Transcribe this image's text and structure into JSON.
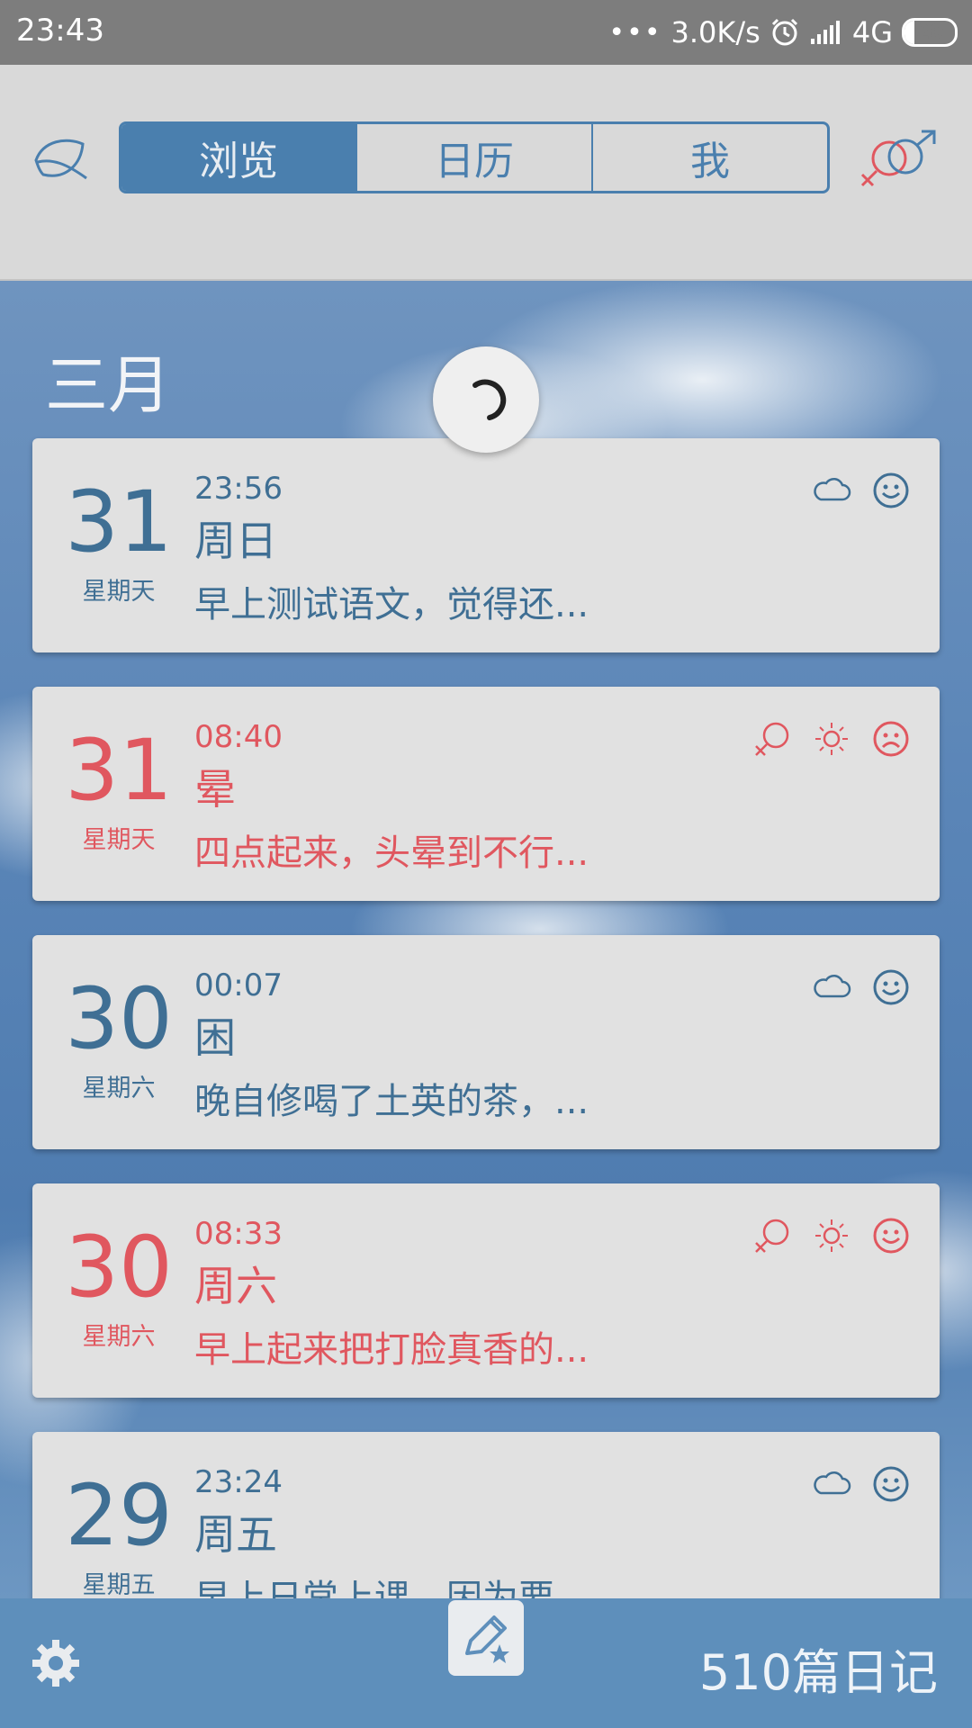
{
  "status_bar": {
    "time": "23:43",
    "dots": "•••",
    "net_speed": "3.0K/s",
    "network": "4G",
    "battery": "20",
    "battery_fraction": 0.2
  },
  "header": {
    "tabs": [
      {
        "label": "浏览",
        "active": true
      },
      {
        "label": "日历",
        "active": false
      },
      {
        "label": "我",
        "active": false
      }
    ],
    "colors": {
      "accent": "#4a7fae",
      "header_bg": "#d9d9d9"
    }
  },
  "month_label": "三月",
  "entries": [
    {
      "day": "31",
      "weekday": "星期天",
      "time": "23:56",
      "title": "周日",
      "excerpt": "早上测试语文，觉得还...",
      "theme": "blue",
      "icons": [
        "cloud-icon",
        "smile-face-icon"
      ]
    },
    {
      "day": "31",
      "weekday": "星期天",
      "time": "08:40",
      "title": "晕",
      "excerpt": "四点起来，头晕到不行...",
      "theme": "red",
      "icons": [
        "female-icon",
        "sun-icon",
        "sad-face-icon"
      ]
    },
    {
      "day": "30",
      "weekday": "星期六",
      "time": "00:07",
      "title": "困",
      "excerpt": "晚自修喝了土英的茶，...",
      "theme": "blue",
      "icons": [
        "cloud-icon",
        "smile-face-icon"
      ]
    },
    {
      "day": "30",
      "weekday": "星期六",
      "time": "08:33",
      "title": "周六",
      "excerpt": "早上起来把打脸真香的...",
      "theme": "red",
      "icons": [
        "female-icon",
        "sun-icon",
        "smile-face-icon"
      ]
    },
    {
      "day": "29",
      "weekday": "星期五",
      "time": "23:24",
      "title": "周五",
      "excerpt": "早上日常上课，因为要...",
      "theme": "blue",
      "icons": [
        "cloud-icon",
        "smile-face-icon"
      ]
    }
  ],
  "bottom_bar": {
    "diary_count": "510篇日记"
  },
  "theme_colors": {
    "blue": "#3f6f94",
    "red": "#e0575f",
    "bottom_bar": "#5e8fbb"
  }
}
